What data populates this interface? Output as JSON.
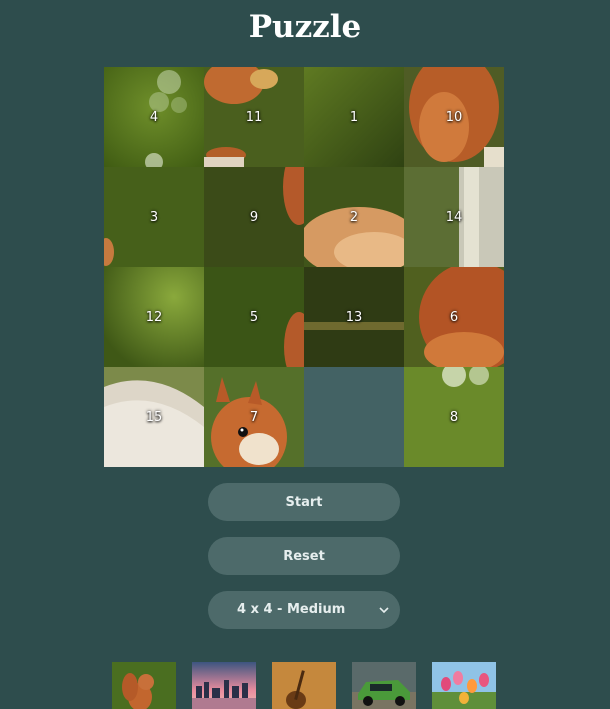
{
  "title": "Puzzle",
  "board": {
    "tiles": [
      "4",
      "11",
      "1",
      "10",
      "3",
      "9",
      "2",
      "14",
      "12",
      "5",
      "13",
      "6",
      "15",
      "7",
      "",
      "8"
    ]
  },
  "buttons": {
    "start": "Start",
    "reset": "Reset"
  },
  "difficulty": {
    "selected": "4 x 4 - Medium"
  },
  "thumbnails": [
    "squirrel",
    "city-skyline",
    "guitar",
    "rally-car",
    "tulips"
  ],
  "colors": {
    "background": "#2e4d4d",
    "button": "#4d6a6a",
    "empty_tile": "#436264"
  }
}
